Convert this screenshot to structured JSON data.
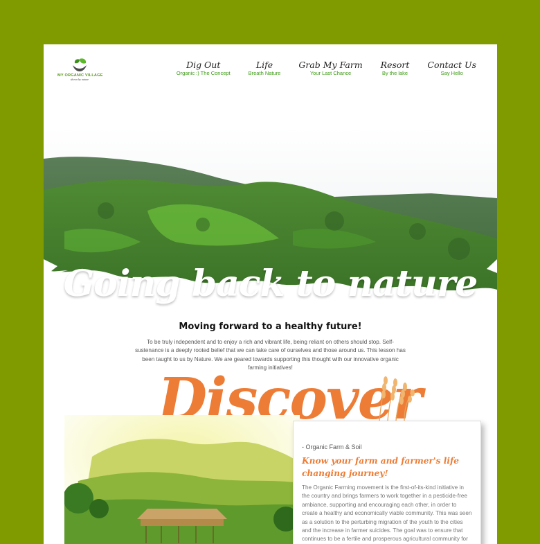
{
  "colors": {
    "page_background": "#7f9b00",
    "accent_orange": "#ed7d36",
    "accent_green": "#3c9a14"
  },
  "logo": {
    "icon": "leaf-hands-icon",
    "title": "MY ORGANIC VILLAGE",
    "tagline": "shown by nature"
  },
  "nav": [
    {
      "label": "Dig Out",
      "sub": "Organic :) The Concept"
    },
    {
      "label": "Life",
      "sub": "Breath Nature"
    },
    {
      "label": "Grab My Farm",
      "sub": "Your Last Chance"
    },
    {
      "label": "Resort",
      "sub": "By the lake"
    },
    {
      "label": "Contact Us",
      "sub": "Say Hello"
    }
  ],
  "hero": {
    "title": "Going back to nature"
  },
  "intro": {
    "heading": "Moving forward to a healthy future!",
    "body": "To be truly independent and to enjoy a rich and vibrant life, being reliant on others should stop.  Self-sustenance is a deeply rooted belief that we can take care of ourselves and those around us.  This lesson has been taught to us by Nature.  We are geared towards supporting this thought with our innovative organic farming initiatives!"
  },
  "discover": {
    "heading": "Discover",
    "decoration": "wheat-icon"
  },
  "card": {
    "kicker": "- Organic Farm & Soil",
    "title": "Know your farm and farmer's life changing journey!",
    "body": "The Organic Farming movement is the first-of-its-kind initiative in the country and brings farmers to work together in a pesticide-free ambiance, supporting and encouraging each other, in order to create a healthy and economically viable community. This was seen as a solution to the perturbing migration of the youth to the cities and the increase in farmer suicides. The goal was to ensure that continues to be a fertile and prosperous agricultural community for the future."
  }
}
